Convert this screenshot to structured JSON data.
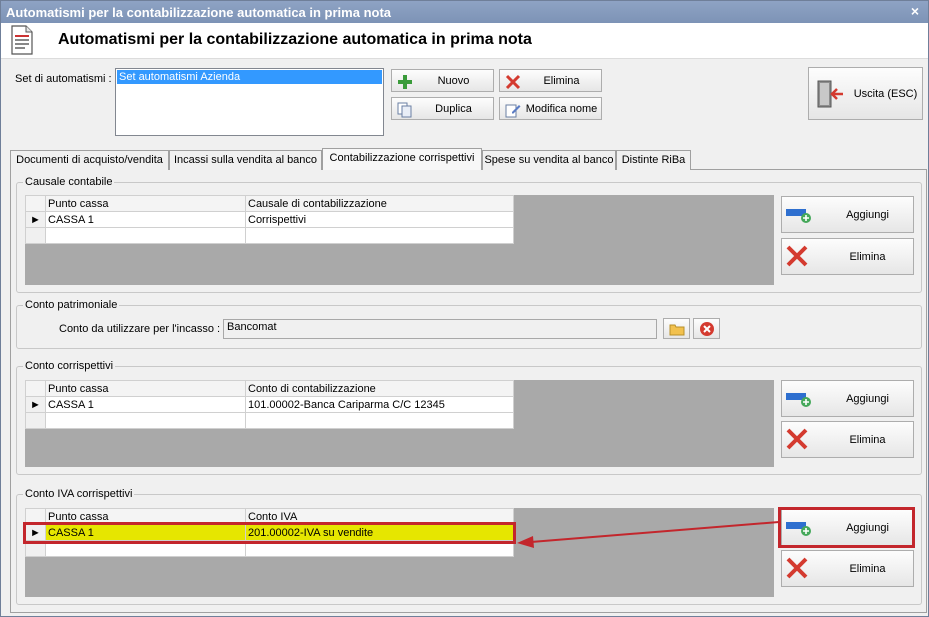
{
  "window": {
    "title": "Automatismi per la contabilizzazione automatica in prima nota"
  },
  "header": {
    "title": "Automatismi per la contabilizzazione automatica in prima nota",
    "icon": "document-icon"
  },
  "set": {
    "label": "Set di automatismi :",
    "items": [
      "Set automatismi Azienda"
    ]
  },
  "toolbar": {
    "nuovo": "Nuovo",
    "elimina": "Elimina",
    "duplica": "Duplica",
    "modifica_nome": "Modifica nome",
    "uscita": "Uscita (ESC)"
  },
  "tabs": [
    "Documenti di acquisto/vendita",
    "Incassi sulla vendita al banco",
    "Contabilizzazione corrispettivi",
    "Spese su vendita al banco",
    "Distinte RiBa"
  ],
  "active_tab": "Contabilizzazione corrispettivi",
  "causale": {
    "title": "Causale contabile",
    "columns": [
      "Punto cassa",
      "Causale di contabilizzazione"
    ],
    "rows": [
      [
        "CASSA 1",
        "Corrispettivi"
      ]
    ],
    "aggiungi": "Aggiungi",
    "elimina": "Elimina"
  },
  "conto_patrimoniale": {
    "title": "Conto patrimoniale",
    "label": "Conto da utilizzare per l'incasso :",
    "value": "Bancomat"
  },
  "conto_corrispettivi": {
    "title": "Conto corrispettivi",
    "columns": [
      "Punto cassa",
      "Conto di contabilizzazione"
    ],
    "rows": [
      [
        "CASSA 1",
        "101.00002-Banca Cariparma C/C 12345"
      ]
    ],
    "aggiungi": "Aggiungi",
    "elimina": "Elimina"
  },
  "conto_iva": {
    "title": "Conto IVA corrispettivi",
    "columns": [
      "Punto cassa",
      "Conto IVA"
    ],
    "rows": [
      [
        "CASSA 1",
        "201.00002-IVA su vendite"
      ]
    ],
    "aggiungi": "Aggiungi",
    "elimina": "Elimina"
  },
  "colors": {
    "highlight": "#e6e600",
    "annotation": "#c3262c",
    "title_bar": "#7d93b6",
    "selection": "#3399ff"
  }
}
